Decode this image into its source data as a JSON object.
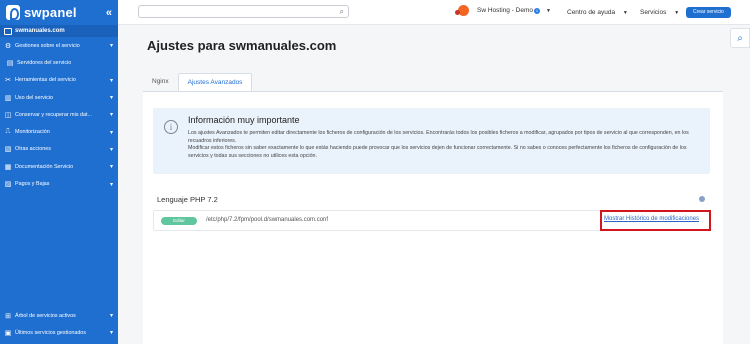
{
  "brand": {
    "name": "swpanel",
    "collapse_icon": "«"
  },
  "sidebar": {
    "domain": "swmanuales.com",
    "items": [
      {
        "label": "Gestiones sobre el servicio",
        "has_chevron": true
      },
      {
        "label": "Servidores del servicio",
        "has_chevron": false
      },
      {
        "label": "Herramientas del servicio",
        "has_chevron": true
      },
      {
        "label": "Uso del servicio",
        "has_chevron": true
      },
      {
        "label": "Conservar y recuperar mis dat...",
        "has_chevron": true
      },
      {
        "label": "Monitorización",
        "has_chevron": true
      },
      {
        "label": "Otras acciones",
        "has_chevron": true
      },
      {
        "label": "Documentación Servicio",
        "has_chevron": true
      },
      {
        "label": "Pagos y Bajas",
        "has_chevron": true
      }
    ],
    "bottom_items": [
      {
        "label": "Árbol de servicios activos"
      },
      {
        "label": "Últimos servicios gestionados"
      }
    ]
  },
  "topbar": {
    "search": {
      "value": "",
      "placeholder": ""
    },
    "account": "Sw Hosting - Demo",
    "account_badge": "1",
    "help": "Centro de ayuda",
    "services": "Servicios",
    "create": "Crear servicio"
  },
  "page": {
    "title_prefix": "Ajustes para",
    "title_domain": "swmanuales.com",
    "tabs": [
      {
        "label": "Nginx",
        "active": false
      },
      {
        "label": "Ajustes Avanzados",
        "active": true
      }
    ]
  },
  "info": {
    "icon": "i",
    "title": "Información muy importante",
    "line1": "Los ajustes Avanzados te permiten editar directamente los ficheros de configuración de los servicios. Encontrarás todos los posibles ficheros a modificar, agrupados por tipos de servicio al que corresponden, en los recuadros inferiores.",
    "line2": "Modificar estos ficheros sin saber exactamente lo que estás haciendo puede provocar que los servicios dejen de funcionar correctamente. Si no sabes o conoces perfectamente los ficheros de configuración de los servicios y todas sus secciones no utilices esta opción."
  },
  "php": {
    "section_title": "Lenguaje PHP 7.2",
    "edit_label": "Editar",
    "path": "/etc/php/7.2/fpm/pool.d/swmanuales.com.conf",
    "history_link": "Mostrar Histórico de modificaciones"
  },
  "colors": {
    "accent": "#1f6fd1",
    "highlight": "#d3161e",
    "edit": "#5fc6a0"
  }
}
